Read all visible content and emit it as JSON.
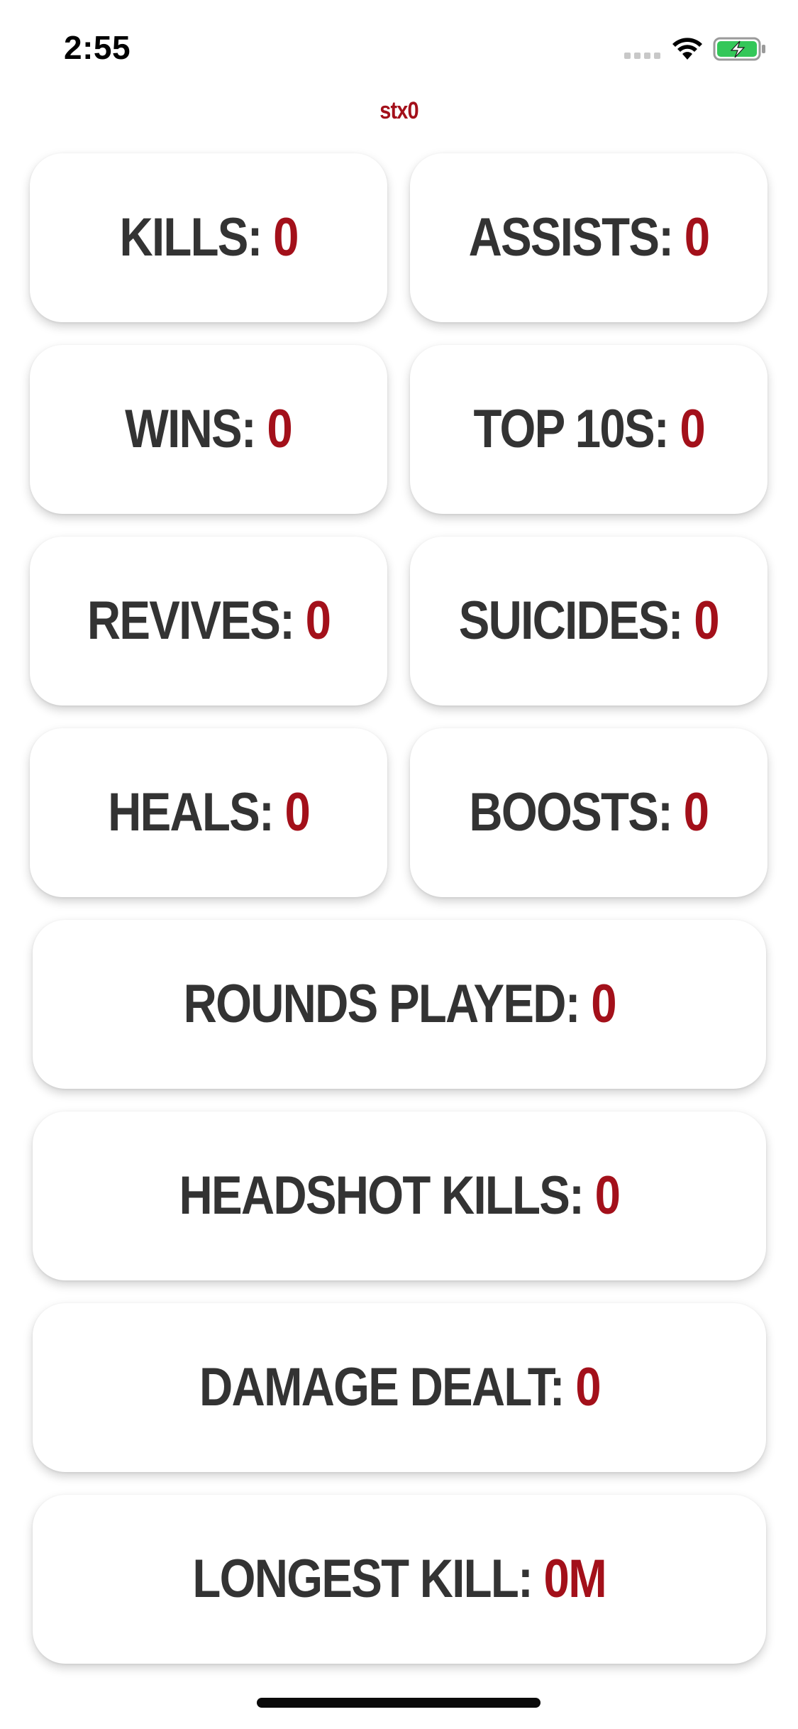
{
  "status_bar": {
    "time": "2:55",
    "icons": [
      "signal-icon",
      "wifi-icon",
      "battery-charging-icon"
    ],
    "battery_color": "#34c759"
  },
  "nav": {
    "title": "stx0"
  },
  "colors": {
    "accent": "#a3101a",
    "label": "#333333",
    "background": "#ffffff"
  },
  "stats": {
    "kills": {
      "label": "KILLS:",
      "value": "0"
    },
    "assists": {
      "label": "ASSISTS:",
      "value": "0"
    },
    "wins": {
      "label": "WINS:",
      "value": "0"
    },
    "top10s": {
      "label": "TOP 10S:",
      "value": "0"
    },
    "revives": {
      "label": "REVIVES:",
      "value": "0"
    },
    "suicides": {
      "label": "SUICIDES:",
      "value": "0"
    },
    "heals": {
      "label": "HEALS:",
      "value": "0"
    },
    "boosts": {
      "label": "BOOSTS:",
      "value": "0"
    },
    "rounds_played": {
      "label": "ROUNDS PLAYED:",
      "value": "0"
    },
    "headshot_kills": {
      "label": "HEADSHOT KILLS:",
      "value": "0"
    },
    "damage_dealt": {
      "label": "DAMAGE DEALT:",
      "value": "0"
    },
    "longest_kill": {
      "label": "LONGEST KILL:",
      "value": "0M"
    }
  }
}
